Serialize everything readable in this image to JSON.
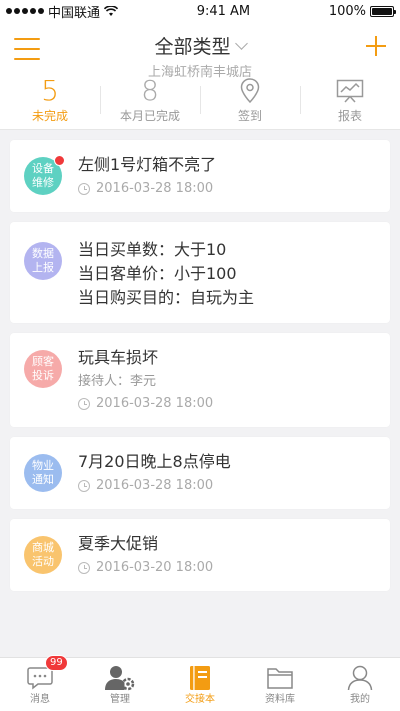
{
  "status_bar": {
    "carrier": "中国联通",
    "time": "9:41 AM",
    "battery": "100%"
  },
  "header": {
    "title": "全部类型",
    "subtitle": "上海虹桥南丰城店"
  },
  "stats": [
    {
      "value": "5",
      "label": "未完成",
      "active": true
    },
    {
      "value": "8",
      "label": "本月已完成",
      "active": false
    },
    {
      "label": "签到",
      "icon": "location-pin-icon"
    },
    {
      "label": "报表",
      "icon": "report-chart-icon"
    }
  ],
  "cards": [
    {
      "badge": "设备维修",
      "badge_color": "#5ed1c2",
      "unread_dot": true,
      "title": "左侧1号灯箱不亮了",
      "time": "2016-03-28   18:00"
    },
    {
      "badge": "数据上报",
      "badge_color": "#b3b4f0",
      "lines": [
        "当日买单数：大于10",
        "当日客单价：小于100",
        "当日购买目的：自玩为主"
      ]
    },
    {
      "badge": "顾客投诉",
      "badge_color": "#f6aaa9",
      "title": "玩具车损坏",
      "sub": "接待人：李元",
      "time": "2016-03-28   18:00"
    },
    {
      "badge": "物业通知",
      "badge_color": "#9bbcef",
      "title": "7月20日晚上8点停电",
      "time": "2016-03-28   18:00"
    },
    {
      "badge": "商城活动",
      "badge_color": "#f9c46e",
      "title": "夏季大促销",
      "time": "2016-03-20   18:00"
    }
  ],
  "tabbar": [
    {
      "label": "消息",
      "icon": "message-icon",
      "badge": "99"
    },
    {
      "label": "管理",
      "icon": "user-gear-icon"
    },
    {
      "label": "交接本",
      "icon": "notebook-icon",
      "active": true
    },
    {
      "label": "资料库",
      "icon": "folder-icon"
    },
    {
      "label": "我的",
      "icon": "person-icon"
    }
  ],
  "colors": {
    "accent": "#f39c12",
    "badge_red": "#f0393a"
  }
}
